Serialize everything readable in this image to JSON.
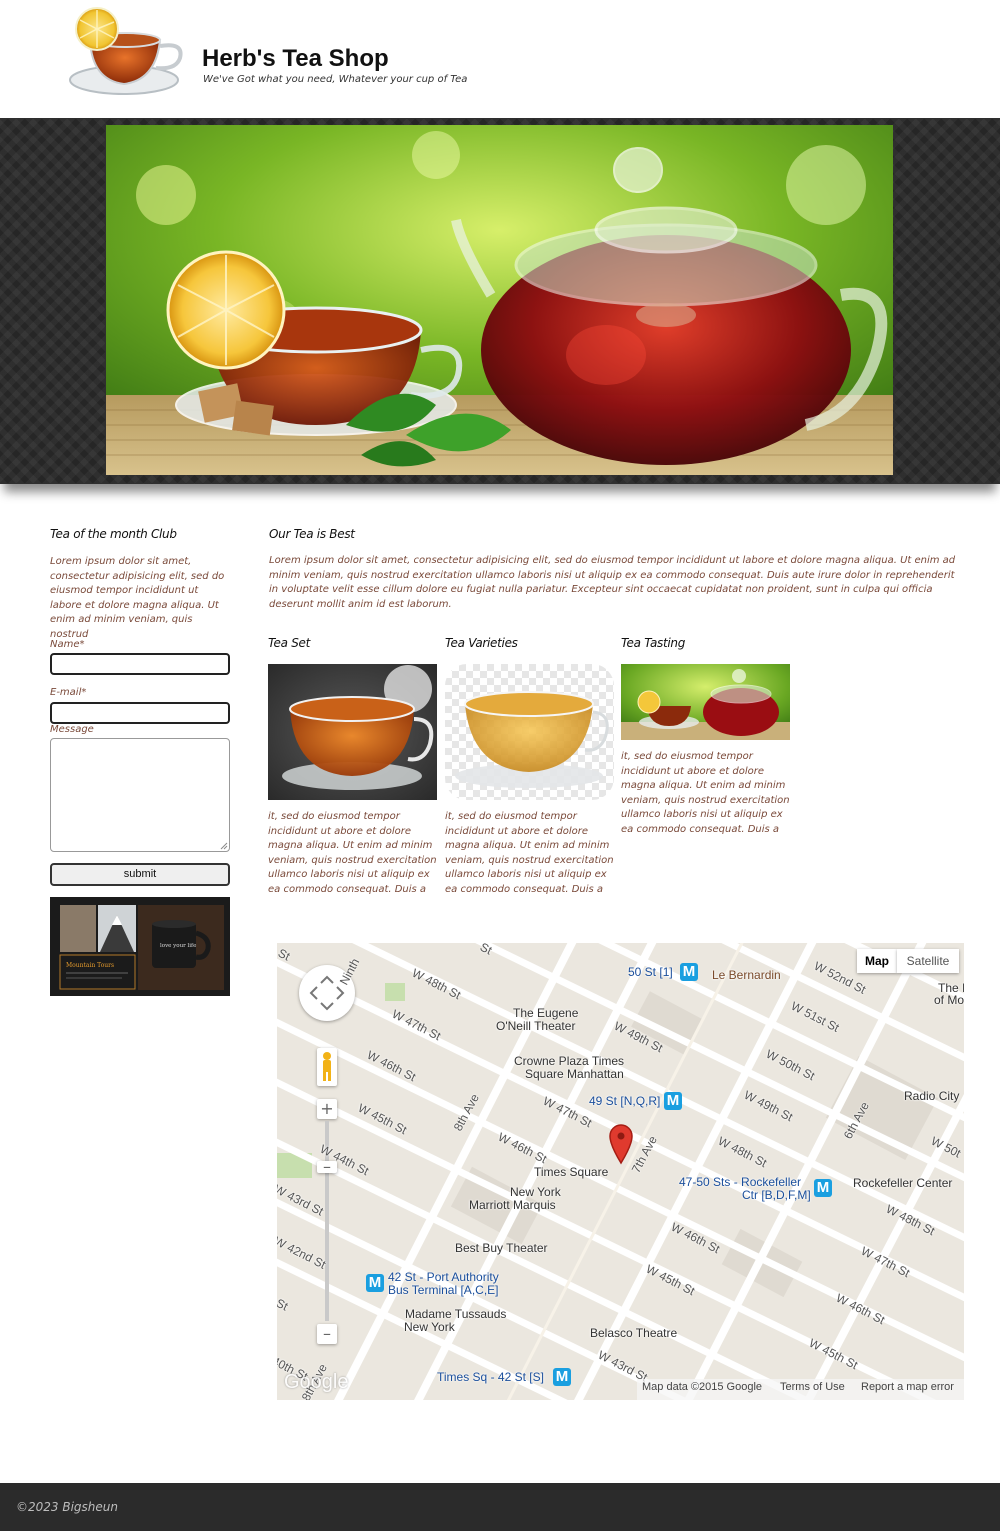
{
  "header": {
    "title": "Herb's Tea Shop",
    "tagline": "We've Got what you need, Whatever your cup of Tea",
    "logo_icon": "tea-cup-logo"
  },
  "sidebar": {
    "title": "Tea of the month Club",
    "text": "Lorem ipsum dolor sit amet, consectetur adipisicing elit, sed do eiusmod tempor incididunt ut labore et dolore magna aliqua. Ut enim ad minim veniam, quis nostrud",
    "form": {
      "name_label": "Name*",
      "email_label": "E-mail*",
      "message_label": "Message",
      "submit_label": "submit"
    },
    "ad": {
      "caption": "Mountain Tours",
      "mug_text": "love your life"
    }
  },
  "main": {
    "title": "Our Tea is Best",
    "text": "Lorem ipsum dolor sit amet, consectetur adipisicing elit, sed do eiusmod tempor incididunt ut labore et dolore magna aliqua. Ut enim ad minim veniam, quis nostrud exercitation ullamco laboris nisi ut aliquip ex ea commodo consequat. Duis aute irure dolor in reprehenderit in voluptate velit esse cillum dolore eu fugiat nulla pariatur. Excepteur sint occaecat cupidatat non proident, sunt in culpa qui officia deserunt mollit anim id est laborum.",
    "cards": [
      {
        "title": "Tea Set",
        "text": "it, sed do eiusmod tempor incididunt ut abore et dolore magna aliqua. Ut enim ad minim veniam, quis nostrud exercitation ullamco laboris nisi ut aliquip ex ea commodo consequat. Duis a"
      },
      {
        "title": "Tea Varieties",
        "text": "it, sed do eiusmod tempor incididunt ut abore et dolore magna aliqua. Ut enim ad minim veniam, quis nostrud exercitation ullamco laboris nisi ut aliquip ex ea commodo consequat. Duis a"
      },
      {
        "title": "Tea Tasting",
        "text": "it, sed do eiusmod tempor incididunt ut abore et dolore magna aliqua. Ut enim ad minim veniam, quis nostrud exercitation ullamco laboris nisi ut aliquip ex ea commodo consequat. Duis a"
      }
    ]
  },
  "map": {
    "type_map": "Map",
    "type_satellite": "Satellite",
    "places": {
      "le_bernardin": "Le Bernardin",
      "eugene_oneill_1": "The Eugene",
      "eugene_oneill_2": "O'Neill Theater",
      "crowne_plaza_1": "Crowne Plaza Times",
      "crowne_plaza_2": "Square Manhattan",
      "radio_city": "Radio City",
      "times_square": "Times Square",
      "marriott_1": "New York",
      "marriott_2": "Marriott Marquis",
      "rockefeller": "Rockefeller Center",
      "best_buy": "Best Buy Theater",
      "tussauds_1": "Madame Tussauds",
      "tussauds_2": "New York",
      "belasco": "Belasco Theatre",
      "edge_top_right_1": "The I",
      "edge_top_right_2": "of Mo"
    },
    "stations": {
      "s50": "50 St [1]",
      "s49": "49 St [N,Q,R]",
      "s4750_1": "47-50 Sts - Rockefeller",
      "s4750_2": "Ctr [B,D,F,M]",
      "s42pa_1": "42 St - Port Authority",
      "s42pa_2": "Bus Terminal [A,C,E]",
      "s42ts": "Times Sq - 42 St [S]",
      "metro_symbol": "M"
    },
    "streets": {
      "w48_a": "W 48th St",
      "w47_a": "W 47th St",
      "w46_a": "W 46th St",
      "w45_a": "W 45th St",
      "w44_a": "W 44th St",
      "w43_a": "W 43rd St",
      "w42_a": "W 42nd St",
      "w49_b": "W 49th St",
      "w47_b": "W 47th St",
      "w46_b": "W 46th St",
      "w52": "W 52nd St",
      "w51": "W 51st St",
      "w50": "W 50th St",
      "w49_c": "W 49th St",
      "w48_c": "W 48th St",
      "w46_c": "W 46th St",
      "w45_c": "W 45th St",
      "w43_c": "W 43rd St",
      "w50_d": "W 50t",
      "w48_d": "W 48th St",
      "w47_d": "W 47th St",
      "w46_d": "W 46th St",
      "w45_d": "W 45th St",
      "ave8": "8th Ave",
      "ave7": "7th Ave",
      "ave6": "6th Ave",
      "ave8b": "8th Ave",
      "ninth": "Ninth",
      "st_a": "St",
      "st_b": "St",
      "st_c": "St",
      "st_d": "40th St"
    },
    "footer": {
      "data": "Map data ©2015 Google",
      "terms": "Terms of Use",
      "report": "Report a map error",
      "google": "Google"
    }
  },
  "footer": {
    "copyright": "©2023 Bigsheun"
  }
}
